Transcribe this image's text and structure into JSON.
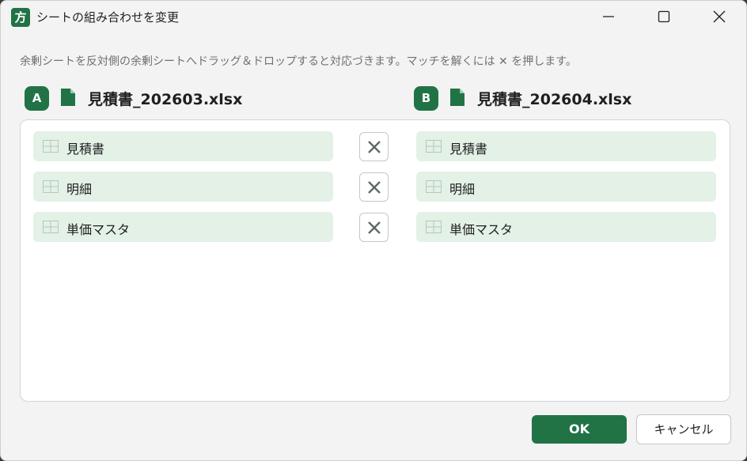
{
  "window": {
    "title": "シートの組み合わせを変更",
    "app_icon_glyph": "方",
    "accent_color": "#217346"
  },
  "instruction": "余剰シートを反対側の余剰シートへドラッグ＆ドロップすると対応づきます。マッチを解くには ✕ を押します。",
  "file_a": {
    "badge": "A",
    "name": "見積書_202603.xlsx",
    "icon": "document-icon"
  },
  "file_b": {
    "badge": "B",
    "name": "見積書_202604.xlsx",
    "icon": "document-icon"
  },
  "pairs": [
    {
      "left": "見積書",
      "right": "見積書"
    },
    {
      "left": "明細",
      "right": "明細"
    },
    {
      "left": "単価マスタ",
      "right": "単価マスタ"
    }
  ],
  "sheet_chip_color": "#e3f1e7",
  "buttons": {
    "ok": "OK",
    "cancel": "キャンセル"
  }
}
